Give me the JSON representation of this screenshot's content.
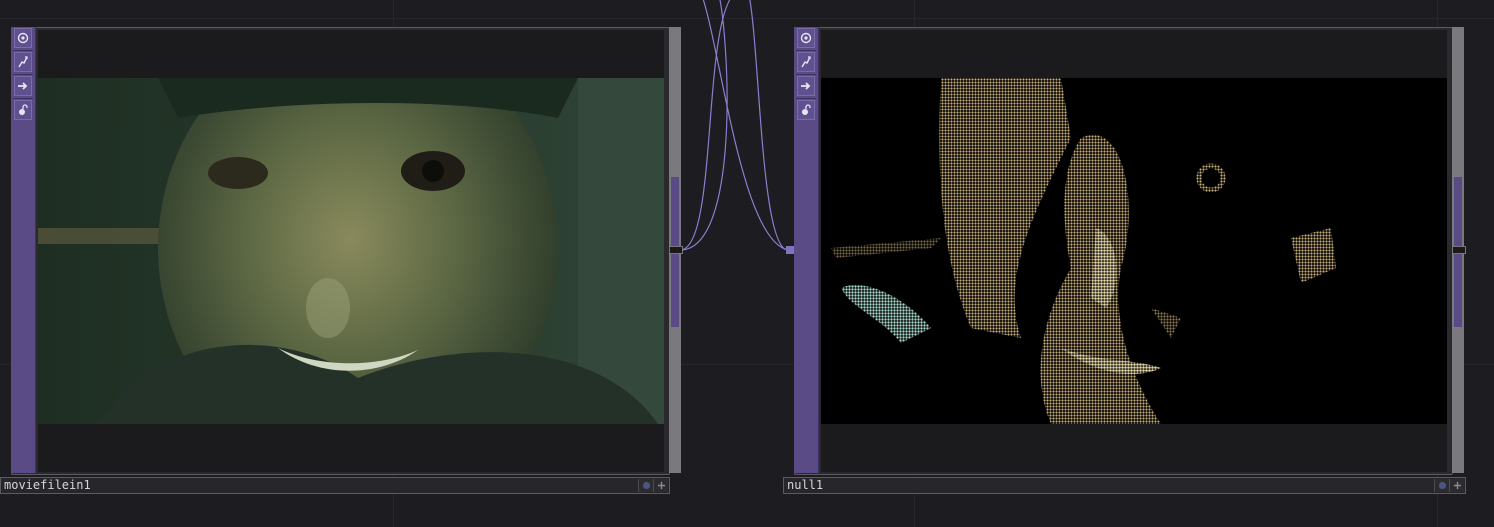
{
  "colors": {
    "background": "#1c1c21",
    "sidebar": "#5a4a86",
    "wire": "#8a7fd0",
    "viewer": "#1b1b1d"
  },
  "nodes": [
    {
      "id": "movie",
      "name": "moviefilein1",
      "sidebar_icons": [
        "viewer-toggle-icon",
        "bypass-icon",
        "output-arrow-icon",
        "lock-icon"
      ],
      "viewer_content": "video-frame-close-up-face",
      "namebar_icons": [
        "display-flag-icon",
        "add-icon"
      ]
    },
    {
      "id": "null",
      "name": "null1",
      "sidebar_icons": [
        "viewer-toggle-icon",
        "bypass-icon",
        "output-arrow-icon",
        "lock-icon"
      ],
      "viewer_content": "dithered-face-frame",
      "namebar_icons": [
        "display-flag-icon",
        "add-icon"
      ]
    }
  ]
}
